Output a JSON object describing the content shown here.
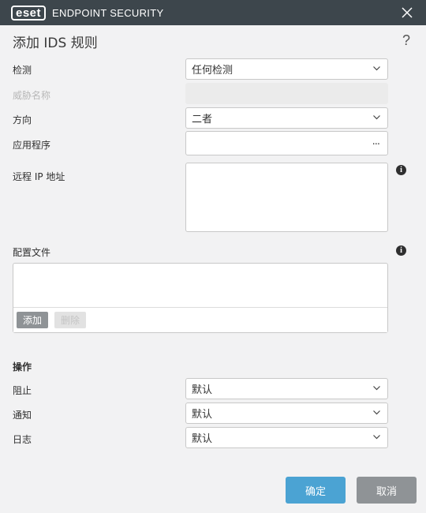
{
  "titlebar": {
    "logo_text": "eset",
    "app_title": "ENDPOINT SECURITY"
  },
  "dialog": {
    "title": "添加 IDS 规则",
    "help": "?"
  },
  "fields": {
    "detection": {
      "label": "检测",
      "value": "任何检测"
    },
    "threat_name": {
      "label": "威胁名称",
      "value": ""
    },
    "direction": {
      "label": "方向",
      "value": "二者"
    },
    "application": {
      "label": "应用程序",
      "value": "",
      "browse": "..."
    },
    "remote_ip": {
      "label": "远程 IP 地址",
      "value": ""
    }
  },
  "profiles": {
    "label": "配置文件",
    "items": [],
    "add_label": "添加",
    "delete_label": "删除"
  },
  "actions": {
    "heading": "操作",
    "block": {
      "label": "阻止",
      "value": "默认"
    },
    "notify": {
      "label": "通知",
      "value": "默认"
    },
    "log": {
      "label": "日志",
      "value": "默认"
    }
  },
  "footer": {
    "ok_label": "确定",
    "cancel_label": "取消"
  },
  "colors": {
    "titlebar": "#3d464c",
    "primary_button": "#4ba3d3",
    "secondary_button": "#8f9396",
    "background": "#f2f2f3"
  },
  "icons": {
    "close": "close-icon",
    "help": "help-icon",
    "info": "info-icon",
    "dropdown": "chevron-down-icon"
  }
}
